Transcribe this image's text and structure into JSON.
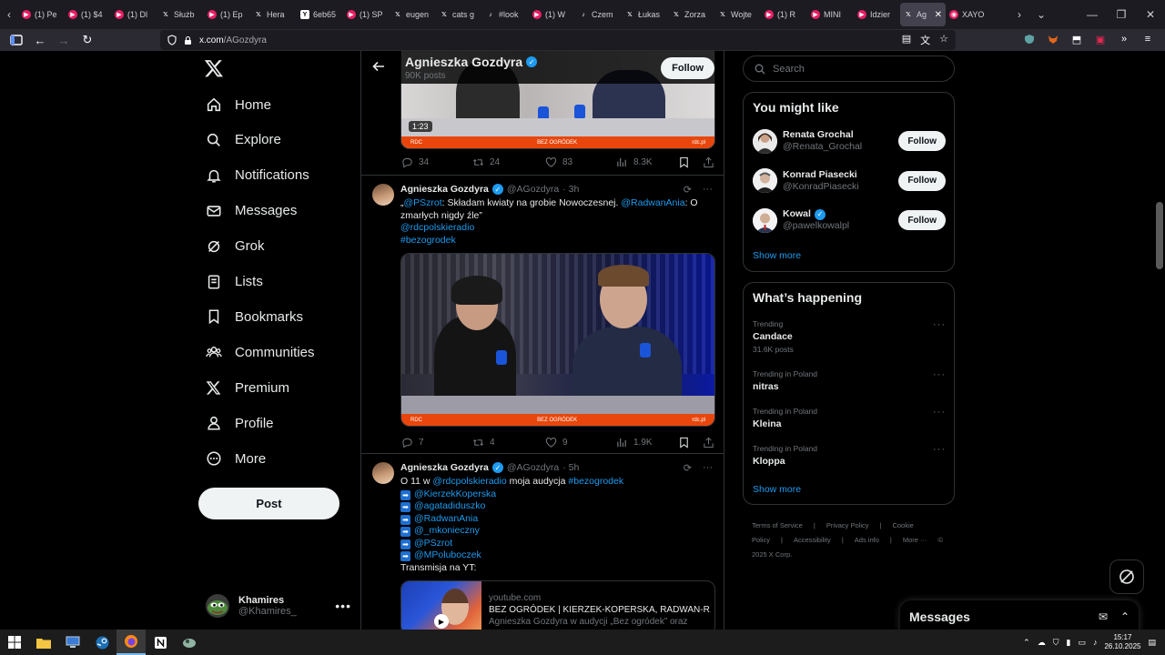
{
  "browser": {
    "tabs": [
      {
        "icon": "youtube",
        "label": "(1) Pe"
      },
      {
        "icon": "youtube",
        "label": "(1) $4"
      },
      {
        "icon": "youtube",
        "label": "(1) Dl"
      },
      {
        "icon": "x",
        "label": "Służb"
      },
      {
        "icon": "youtube",
        "label": "(1) Ep"
      },
      {
        "icon": "x",
        "label": "Hera"
      },
      {
        "icon": "ycombinator",
        "label": "6eb65"
      },
      {
        "icon": "youtube",
        "label": "(1) SP"
      },
      {
        "icon": "x",
        "label": "eugen"
      },
      {
        "icon": "x",
        "label": "cats g"
      },
      {
        "icon": "tiktok",
        "label": "#look"
      },
      {
        "icon": "youtube",
        "label": "(1) W"
      },
      {
        "icon": "tiktok",
        "label": "Czem"
      },
      {
        "icon": "x",
        "label": "Łukas"
      },
      {
        "icon": "x",
        "label": "Zorza"
      },
      {
        "icon": "x",
        "label": "Wojte"
      },
      {
        "icon": "youtube",
        "label": "(1) R"
      },
      {
        "icon": "youtube",
        "label": "MINI"
      },
      {
        "icon": "youtube",
        "label": "Idzier"
      },
      {
        "icon": "x",
        "label": "Ag",
        "active": true
      },
      {
        "icon": "firefox",
        "label": "XAYO"
      }
    ],
    "url_host": "x.com",
    "url_path": "/AGozdyra"
  },
  "sidebar": {
    "items": [
      {
        "label": "Home",
        "icon": "home-icon"
      },
      {
        "label": "Explore",
        "icon": "search-icon"
      },
      {
        "label": "Notifications",
        "icon": "bell-icon"
      },
      {
        "label": "Messages",
        "icon": "envelope-icon"
      },
      {
        "label": "Grok",
        "icon": "grok-icon"
      },
      {
        "label": "Lists",
        "icon": "lists-icon"
      },
      {
        "label": "Bookmarks",
        "icon": "bookmark-icon"
      },
      {
        "label": "Communities",
        "icon": "communities-icon"
      },
      {
        "label": "Premium",
        "icon": "x-icon"
      },
      {
        "label": "Profile",
        "icon": "person-icon"
      },
      {
        "label": "More",
        "icon": "more-circle-icon"
      }
    ],
    "post_label": "Post",
    "account": {
      "name": "Khamires",
      "handle": "@Khamires_",
      "more": "•••"
    }
  },
  "profile_header": {
    "name": "Agnieszka Gozdyra",
    "posts": "90K posts",
    "follow": "Follow"
  },
  "tweets": [
    {
      "video_duration": "1:23",
      "video_banner_center": "BEZ OGRÓDEK",
      "video_banner_right": "rdc.pl",
      "stats": {
        "replies": "34",
        "reposts": "24",
        "likes": "83",
        "views": "8.3K"
      }
    },
    {
      "name": "Agnieszka Gozdyra",
      "handle": "@AGozdyra",
      "time": "· 3h",
      "line1_prefix": "„",
      "mention1": "@PSzrot",
      "line1_mid": ": Składam kwiaty na grobie Nowoczesnej. ",
      "mention2": "@RadwanAnia",
      "line1_suffix": ": O",
      "line2": "zmarłych nigdy źle”",
      "mention3": "@rdcpolskieradio",
      "hashtag": "#bezogrodek",
      "video_banner_center": "BEZ OGRÓDEK",
      "video_banner_right": "rdc.pl",
      "stats": {
        "replies": "7",
        "reposts": "4",
        "likes": "9",
        "views": "1.9K"
      }
    },
    {
      "name": "Agnieszka Gozdyra",
      "handle": "@AGozdyra",
      "time": "· 5h",
      "line1_prefix": "O 11 w ",
      "mention1": "@rdcpolskieradio",
      "line1_mid": " moja audycja ",
      "hashtag": "#bezogrodek",
      "list": [
        "@KierzekKoperska",
        "@agatadiduszko",
        "@RadwanAnia",
        "@_mkonieczny",
        "@PSzrot",
        "@MPoluboczek"
      ],
      "last_line": "Transmisja na YT:",
      "card": {
        "domain": "youtube.com",
        "title": "BEZ OGRÓDEK | KIERZEK-KOPERSKA, RADWAN-R...",
        "desc": "Agnieszka Gozdyra w audycji „Bez ogródek” oraz"
      }
    }
  ],
  "right": {
    "search_placeholder": "Search",
    "you_might_like": {
      "title": "You might like",
      "users": [
        {
          "name": "Renata Grochal",
          "handle": "@Renata_Grochal",
          "verified": false,
          "follow": "Follow"
        },
        {
          "name": "Konrad Piasecki",
          "handle": "@KonradPiasecki",
          "verified": false,
          "follow": "Follow"
        },
        {
          "name": "Kowal",
          "handle": "@pawelkowalpl",
          "verified": true,
          "follow": "Follow"
        }
      ],
      "show_more": "Show more"
    },
    "whats_happening": {
      "title": "What’s happening",
      "trends": [
        {
          "label": "Trending",
          "name": "Candace",
          "posts": "31.6K posts"
        },
        {
          "label": "Trending in Poland",
          "name": "nitras",
          "posts": ""
        },
        {
          "label": "Trending in Poland",
          "name": "Kleina",
          "posts": ""
        },
        {
          "label": "Trending in Poland",
          "name": "Kloppa",
          "posts": ""
        }
      ],
      "show_more": "Show more"
    },
    "footer": [
      "Terms of Service",
      "|",
      "Privacy Policy",
      "|",
      "Cookie Policy",
      "|",
      "Accessibility",
      "|",
      "Ads info",
      "|",
      "More ···",
      "© 2025 X Corp."
    ]
  },
  "messages_drawer": {
    "title": "Messages"
  },
  "taskbar": {
    "time": "15:17",
    "date": "26.10.2025"
  },
  "colors": {
    "accent": "#1d9bf0",
    "background": "#000000",
    "border": "#2f3336",
    "muted": "#71767b"
  }
}
